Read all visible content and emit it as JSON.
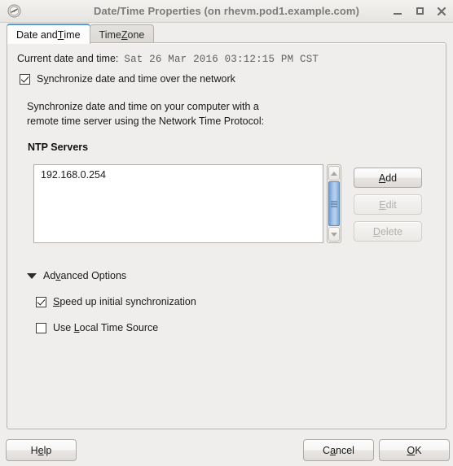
{
  "window": {
    "title": "Date/Time Properties (on rhevm.pod1.example.com)",
    "icon": "clock-icon",
    "controls": {
      "minimize": "minimize-icon",
      "maximize": "maximize-icon",
      "close": "close-icon"
    }
  },
  "tabs": [
    {
      "label_before": "Date and ",
      "mnemonic": "T",
      "label_after": "ime",
      "active": true
    },
    {
      "label_before": "Time ",
      "mnemonic": "Z",
      "label_after": "one",
      "active": false
    }
  ],
  "main": {
    "current_datetime_label": "Current date and time:",
    "current_datetime_value": "Sat 26 Mar 2016 03:12:15 PM CST",
    "sync_checkbox": {
      "checked": true,
      "label_before": "S",
      "mnemonic": "y",
      "label_after": "nchronize date and time over the network"
    },
    "description_line1": "Synchronize date and time on your computer with a",
    "description_line2": "remote time server using the Network Time Protocol:",
    "ntp_heading": "NTP Servers",
    "ntp_servers": [
      "192.168.0.254"
    ],
    "side_buttons": [
      {
        "label_before": "",
        "mnemonic": "A",
        "label_after": "dd",
        "enabled": true
      },
      {
        "label_before": "",
        "mnemonic": "E",
        "label_after": "dit",
        "enabled": false
      },
      {
        "label_before": "",
        "mnemonic": "D",
        "label_after": "elete",
        "enabled": false
      }
    ],
    "advanced": {
      "expanded": true,
      "label_before": "Ad",
      "mnemonic": "v",
      "label_after": "anced Options",
      "options": [
        {
          "checked": true,
          "label_before": "",
          "mnemonic": "S",
          "label_after": "peed up initial synchronization"
        },
        {
          "checked": false,
          "label_before": "Use ",
          "mnemonic": "L",
          "label_after": "ocal Time Source"
        }
      ]
    }
  },
  "footer": {
    "help": {
      "label_before": "H",
      "mnemonic": "e",
      "label_after": "lp"
    },
    "cancel": {
      "label_before": "C",
      "mnemonic": "a",
      "label_after": "ncel"
    },
    "ok": {
      "label_before": "",
      "mnemonic": "O",
      "label_after": "K"
    }
  },
  "colors": {
    "background": "#efeeec",
    "accent": "#5b9bd5",
    "title_text": "#7b7b7b",
    "mono_text": "#5f5f5f"
  }
}
